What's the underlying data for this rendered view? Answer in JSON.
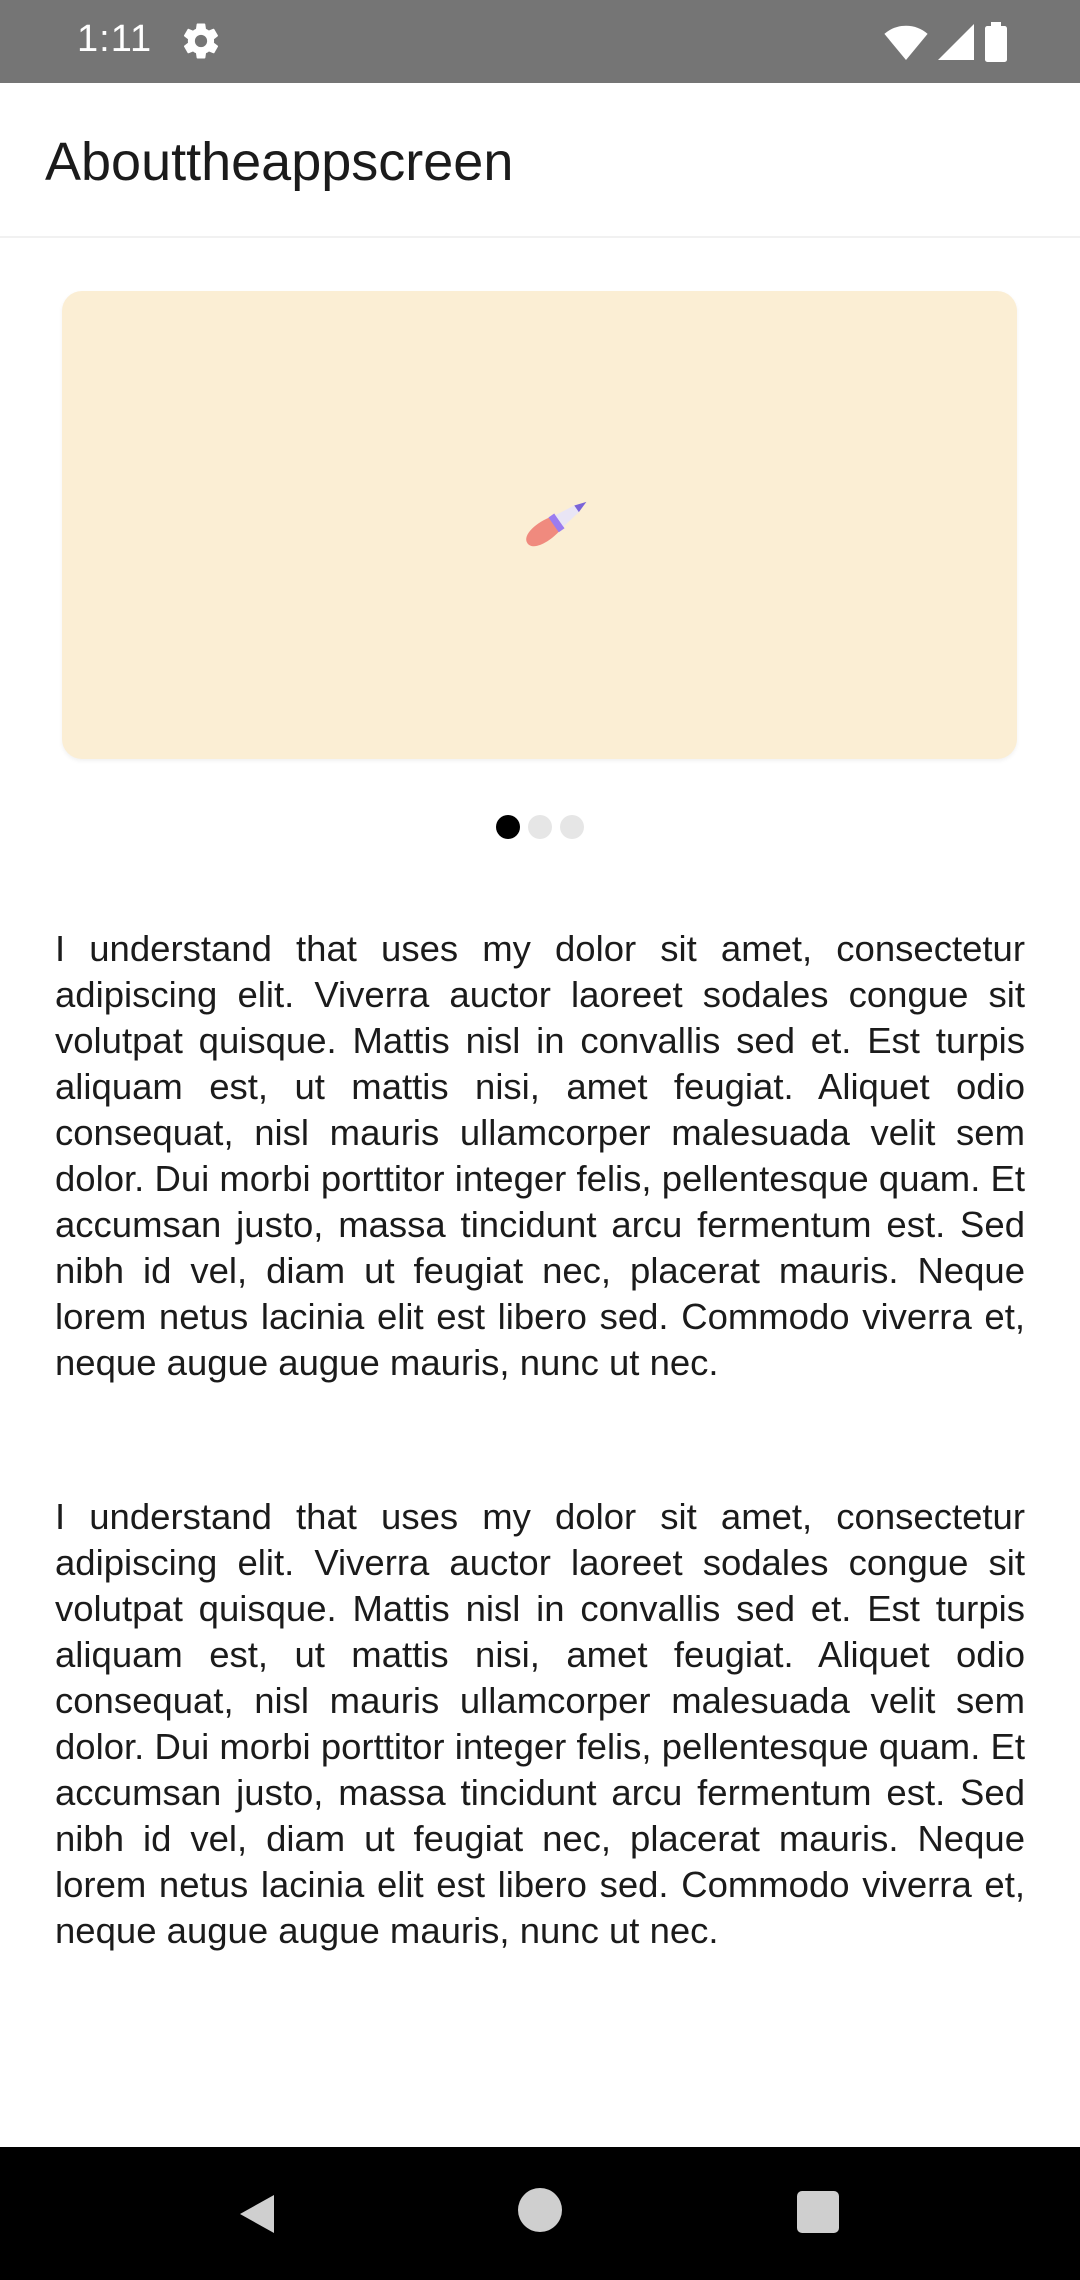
{
  "status_bar": {
    "time": "1:11",
    "icons": [
      "gear-icon",
      "wifi-icon",
      "signal-icon",
      "battery-icon"
    ]
  },
  "app_bar": {
    "title": "Abouttheappscreen"
  },
  "carousel": {
    "illustration_icon": "paintbrush-icon",
    "background_color": "#fbeed4",
    "page_count": 3,
    "active_page": 1
  },
  "content": {
    "paragraphs": [
      "I understand that uses my dolor sit amet, consectetur adipiscing elit. Viverra auctor laoreet sodales congue sit volutpat quisque. Mattis nisl in convallis sed et. Est turpis aliquam est, ut mattis nisi, amet feugiat. Aliquet odio consequat, nisl mauris ullamcorper malesuada velit sem dolor. Dui morbi porttitor integer felis, pellentesque quam. Et accumsan justo, massa tincidunt arcu fermentum est. Sed nibh id vel, diam ut feugiat nec, placerat mauris. Neque lorem netus lacinia elit est libero sed. Commodo viverra et, neque augue augue mauris, nunc ut nec.",
      "I understand that uses my dolor sit amet, consectetur adipiscing elit. Viverra auctor laoreet sodales congue sit volutpat quisque. Mattis nisl in convallis sed et. Est turpis aliquam est, ut mattis nisi, amet feugiat. Aliquet odio consequat, nisl mauris ullamcorper malesuada velit sem dolor. Dui morbi porttitor integer felis, pellentesque quam. Et accumsan justo, massa tincidunt arcu fermentum est. Sed nibh id vel, diam ut feugiat nec, placerat mauris. Neque lorem netus lacinia elit est libero sed. Commodo viverra et, neque augue augue mauris, nunc ut nec."
    ]
  },
  "nav_bar": {
    "icons": [
      "back-icon",
      "home-icon",
      "recents-icon"
    ]
  }
}
